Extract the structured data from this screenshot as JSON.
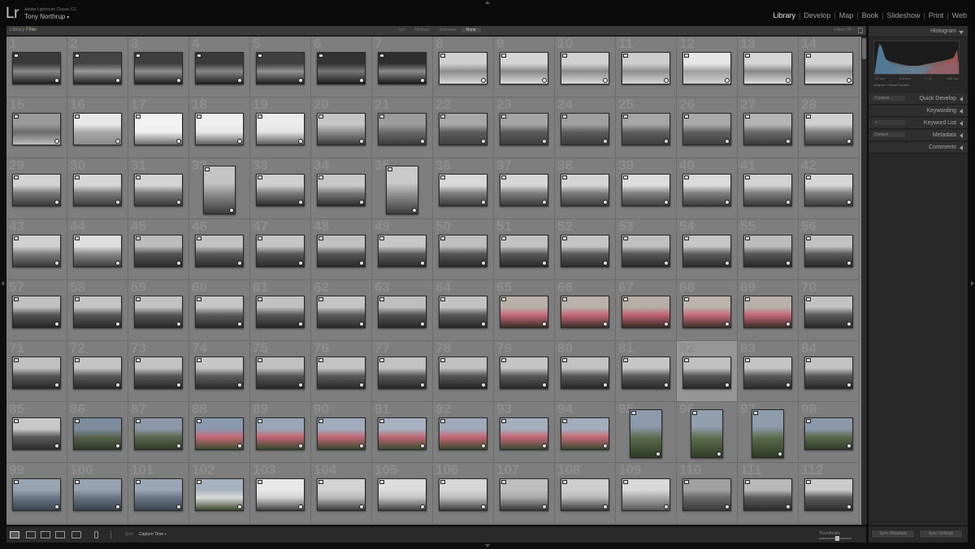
{
  "app": {
    "logo": "Lr",
    "app_name": "Adobe Lightroom Classic CC",
    "user_name": "Tony Northrup",
    "user_caret": "▾"
  },
  "modules": [
    {
      "label": "Library",
      "active": true
    },
    {
      "label": "Develop",
      "active": false
    },
    {
      "label": "Map",
      "active": false
    },
    {
      "label": "Book",
      "active": false
    },
    {
      "label": "Slideshow",
      "active": false
    },
    {
      "label": "Print",
      "active": false
    },
    {
      "label": "Web",
      "active": false
    }
  ],
  "filter_bar": {
    "title_prefix": "Library ",
    "title_accent": "Filter",
    "tabs": [
      {
        "label": "Text",
        "active": false
      },
      {
        "label": "Attribute",
        "active": false
      },
      {
        "label": "Metadata",
        "active": false
      },
      {
        "label": "None",
        "active": true
      }
    ],
    "filters_off": "Filters Off ÷"
  },
  "grid": {
    "columns": 14,
    "rows": 8,
    "selected_index": 81,
    "cells": [
      {
        "n": "1",
        "o": "land",
        "c": [
          "#3a3a3a",
          "#8a8a8a",
          "#1e1e1e"
        ]
      },
      {
        "n": "2",
        "o": "land",
        "c": [
          "#444",
          "#999",
          "#222"
        ]
      },
      {
        "n": "3",
        "o": "land",
        "c": [
          "#3e3e3e",
          "#8e8e8e",
          "#1f1f1f"
        ]
      },
      {
        "n": "4",
        "o": "land",
        "c": [
          "#3a3a3a",
          "#888",
          "#202020"
        ]
      },
      {
        "n": "5",
        "o": "land",
        "c": [
          "#3f3f3f",
          "#929292",
          "#1e1e1e"
        ]
      },
      {
        "n": "6",
        "o": "land",
        "c": [
          "#333",
          "#777",
          "#1a1a1a"
        ]
      },
      {
        "n": "7",
        "o": "land",
        "c": [
          "#2e2e2e",
          "#8a8a8a",
          "#181818"
        ]
      },
      {
        "n": "8",
        "o": "land",
        "c": [
          "#cfcfcf",
          "#8c8c8c",
          "#d8d8d8"
        ]
      },
      {
        "n": "9",
        "o": "land",
        "c": [
          "#d4d4d4",
          "#888",
          "#dcdcdc"
        ]
      },
      {
        "n": "10",
        "o": "land",
        "c": [
          "#d0d0d0",
          "#8a8a8a",
          "#dadada"
        ]
      },
      {
        "n": "11",
        "o": "land",
        "c": [
          "#cdcdcd",
          "#8e8e8e",
          "#d6d6d6"
        ]
      },
      {
        "n": "12",
        "o": "land",
        "c": [
          "#e6e6e6",
          "#a0a0a0",
          "#d0d0d0"
        ]
      },
      {
        "n": "13",
        "o": "land",
        "c": [
          "#d6d6d6",
          "#868686",
          "#dcdcdc"
        ]
      },
      {
        "n": "14",
        "o": "land",
        "c": [
          "#d2d2d2",
          "#888",
          "#dadada"
        ]
      },
      {
        "n": "15",
        "o": "land",
        "c": [
          "#9a9a9a",
          "#6a6a6a",
          "#bdbdbd"
        ]
      },
      {
        "n": "16",
        "o": "land",
        "c": [
          "#e8e8e8",
          "#a8a8a8",
          "#8a8a8a"
        ]
      },
      {
        "n": "17",
        "o": "land",
        "c": [
          "#f2f2f2",
          "#f0f0f0",
          "#6a6a6a"
        ]
      },
      {
        "n": "18",
        "o": "land",
        "c": [
          "#eeeeee",
          "#e6e6e6",
          "#5e5e5e"
        ]
      },
      {
        "n": "19",
        "o": "land",
        "c": [
          "#ececec",
          "#e2e2e2",
          "#585858"
        ]
      },
      {
        "n": "20",
        "o": "land",
        "c": [
          "#c6c6c6",
          "#8c8c8c",
          "#3a3a3a"
        ]
      },
      {
        "n": "21",
        "o": "land",
        "c": [
          "#9c9c9c",
          "#6a6a6a",
          "#3a3a3a"
        ]
      },
      {
        "n": "22",
        "o": "land",
        "c": [
          "#a8a8a8",
          "#5c5c5c",
          "#404040"
        ]
      },
      {
        "n": "23",
        "o": "land",
        "c": [
          "#a4a4a4",
          "#5a5a5a",
          "#3e3e3e"
        ]
      },
      {
        "n": "24",
        "o": "land",
        "c": [
          "#a0a0a0",
          "#5c5c5c",
          "#3a3a3a"
        ]
      },
      {
        "n": "25",
        "o": "land",
        "c": [
          "#a6a6a6",
          "#5e5e5e",
          "#3c3c3c"
        ]
      },
      {
        "n": "26",
        "o": "land",
        "c": [
          "#aaaaaa",
          "#606060",
          "#3e3e3e"
        ]
      },
      {
        "n": "27",
        "o": "land",
        "c": [
          "#b4b4b4",
          "#6a6a6a",
          "#3a3a3a"
        ]
      },
      {
        "n": "28",
        "o": "land",
        "c": [
          "#cfcfcf",
          "#7e7e7e",
          "#3c3c3c"
        ]
      },
      {
        "n": "29",
        "o": "land",
        "c": [
          "#d2d2d2",
          "#7a7a7a",
          "#3a3a3a"
        ]
      },
      {
        "n": "30",
        "o": "land",
        "c": [
          "#d6d6d6",
          "#7c7c7c",
          "#3c3c3c"
        ]
      },
      {
        "n": "31",
        "o": "land",
        "c": [
          "#d4d4d4",
          "#7a7a7a",
          "#3a3a3a"
        ]
      },
      {
        "n": "32",
        "o": "port",
        "c": [
          "#c4c4c4",
          "#8a8a8a",
          "#3a3a3a"
        ]
      },
      {
        "n": "33",
        "o": "land",
        "c": [
          "#cfcfcf",
          "#7c7c7c",
          "#2e2e2e"
        ]
      },
      {
        "n": "34",
        "o": "land",
        "c": [
          "#c8c8c8",
          "#7a7a7a",
          "#2c2c2c"
        ]
      },
      {
        "n": "35",
        "o": "port",
        "c": [
          "#cacaca",
          "#8e8e8e",
          "#3e3e3e"
        ]
      },
      {
        "n": "36",
        "o": "land",
        "c": [
          "#d8d8d8",
          "#808080",
          "#3a3a3a"
        ]
      },
      {
        "n": "37",
        "o": "land",
        "c": [
          "#d6d6d6",
          "#7e7e7e",
          "#3a3a3a"
        ]
      },
      {
        "n": "38",
        "o": "land",
        "c": [
          "#d4d4d4",
          "#7c7c7c",
          "#3c3c3c"
        ]
      },
      {
        "n": "39",
        "o": "land",
        "c": [
          "#dcdcdc",
          "#828282",
          "#3e3e3e"
        ]
      },
      {
        "n": "40",
        "o": "land",
        "c": [
          "#dadada",
          "#808080",
          "#3c3c3c"
        ]
      },
      {
        "n": "41",
        "o": "land",
        "c": [
          "#d2d2d2",
          "#7e7e7e",
          "#3a3a3a"
        ]
      },
      {
        "n": "42",
        "o": "land",
        "c": [
          "#d6d6d6",
          "#808080",
          "#3c3c3c"
        ]
      },
      {
        "n": "43",
        "o": "land",
        "c": [
          "#d0d0d0",
          "#7c7c7c",
          "#3a3a3a"
        ]
      },
      {
        "n": "44",
        "o": "land",
        "c": [
          "#dedede",
          "#888",
          "#404040"
        ]
      },
      {
        "n": "45",
        "o": "land",
        "c": [
          "#bcbcbc",
          "#545454",
          "#2a2a2a"
        ]
      },
      {
        "n": "46",
        "o": "land",
        "c": [
          "#c2c2c2",
          "#5a5a5a",
          "#2c2c2c"
        ]
      },
      {
        "n": "47",
        "o": "land",
        "c": [
          "#c4c4c4",
          "#585858",
          "#2a2a2a"
        ]
      },
      {
        "n": "48",
        "o": "land",
        "c": [
          "#c0c0c0",
          "#565656",
          "#2a2a2a"
        ]
      },
      {
        "n": "49",
        "o": "land",
        "c": [
          "#c6c6c6",
          "#5a5a5a",
          "#2c2c2c"
        ]
      },
      {
        "n": "50",
        "o": "land",
        "c": [
          "#bebebe",
          "#565656",
          "#282828"
        ]
      },
      {
        "n": "51",
        "o": "land",
        "c": [
          "#c2c2c2",
          "#585858",
          "#2a2a2a"
        ]
      },
      {
        "n": "52",
        "o": "land",
        "c": [
          "#c4c4c4",
          "#5a5a5a",
          "#2c2c2c"
        ]
      },
      {
        "n": "53",
        "o": "land",
        "c": [
          "#c0c0c0",
          "#585858",
          "#2a2a2a"
        ]
      },
      {
        "n": "54",
        "o": "land",
        "c": [
          "#c6c6c6",
          "#5c5c5c",
          "#2c2c2c"
        ]
      },
      {
        "n": "55",
        "o": "land",
        "c": [
          "#bcbcbc",
          "#565656",
          "#282828"
        ]
      },
      {
        "n": "56",
        "o": "land",
        "c": [
          "#c2c2c2",
          "#5a5a5a",
          "#2a2a2a"
        ]
      },
      {
        "n": "57",
        "o": "land",
        "c": [
          "#c0c0c0",
          "#545454",
          "#262626"
        ]
      },
      {
        "n": "58",
        "o": "land",
        "c": [
          "#c4c4c4",
          "#585858",
          "#2a2a2a"
        ]
      },
      {
        "n": "59",
        "o": "land",
        "c": [
          "#c2c2c2",
          "#565656",
          "#282828"
        ]
      },
      {
        "n": "60",
        "o": "land",
        "c": [
          "#c6c6c6",
          "#5a5a5a",
          "#2a2a2a"
        ]
      },
      {
        "n": "61",
        "o": "land",
        "c": [
          "#c0c0c0",
          "#585858",
          "#282828"
        ]
      },
      {
        "n": "62",
        "o": "land",
        "c": [
          "#c4c4c4",
          "#5a5a5a",
          "#2a2a2a"
        ]
      },
      {
        "n": "63",
        "o": "land",
        "c": [
          "#bebebe",
          "#545454",
          "#262626"
        ]
      },
      {
        "n": "64",
        "o": "land",
        "c": [
          "#c2c2c2",
          "#585858",
          "#282828"
        ]
      },
      {
        "n": "65",
        "o": "land",
        "c": [
          "#b8b0a8",
          "#c86a7a",
          "#3a2e28"
        ]
      },
      {
        "n": "66",
        "o": "land",
        "c": [
          "#bab2aa",
          "#c46678",
          "#3c302a"
        ]
      },
      {
        "n": "67",
        "o": "land",
        "c": [
          "#b6aea6",
          "#c26274",
          "#3a2c26"
        ]
      },
      {
        "n": "68",
        "o": "land",
        "c": [
          "#bcb4ac",
          "#c66a7a",
          "#3c302a"
        ]
      },
      {
        "n": "69",
        "o": "land",
        "c": [
          "#b8b0a8",
          "#c46878",
          "#3a2e28"
        ]
      },
      {
        "n": "70",
        "o": "land",
        "c": [
          "#c2c2c2",
          "#5a5a5a",
          "#2a2a2a"
        ]
      },
      {
        "n": "71",
        "o": "land",
        "c": [
          "#c0c0c0",
          "#565656",
          "#282828"
        ]
      },
      {
        "n": "72",
        "o": "land",
        "c": [
          "#c4c4c4",
          "#5a5a5a",
          "#2a2a2a"
        ]
      },
      {
        "n": "73",
        "o": "land",
        "c": [
          "#c2c2c2",
          "#585858",
          "#282828"
        ]
      },
      {
        "n": "74",
        "o": "land",
        "c": [
          "#c6c6c6",
          "#5c5c5c",
          "#2c2c2c"
        ]
      },
      {
        "n": "75",
        "o": "land",
        "c": [
          "#c0c0c0",
          "#565656",
          "#282828"
        ]
      },
      {
        "n": "76",
        "o": "land",
        "c": [
          "#c4c4c4",
          "#5a5a5a",
          "#2a2a2a"
        ]
      },
      {
        "n": "77",
        "o": "land",
        "c": [
          "#c2c2c2",
          "#585858",
          "#282828"
        ]
      },
      {
        "n": "78",
        "o": "land",
        "c": [
          "#c0c0c0",
          "#565656",
          "#262626"
        ]
      },
      {
        "n": "79",
        "o": "land",
        "c": [
          "#c4c4c4",
          "#5a5a5a",
          "#2a2a2a"
        ]
      },
      {
        "n": "80",
        "o": "land",
        "c": [
          "#c2c2c2",
          "#585858",
          "#282828"
        ]
      },
      {
        "n": "81",
        "o": "land",
        "c": [
          "#c6c6c6",
          "#5a5a5a",
          "#2a2a2a"
        ]
      },
      {
        "n": "82",
        "o": "land",
        "c": [
          "#c0c0c0",
          "#565656",
          "#282828"
        ]
      },
      {
        "n": "83",
        "o": "land",
        "c": [
          "#c4c4c4",
          "#5a5a5a",
          "#2a2a2a"
        ]
      },
      {
        "n": "84",
        "o": "land",
        "c": [
          "#c2c2c2",
          "#585858",
          "#282828"
        ]
      },
      {
        "n": "85",
        "o": "land",
        "c": [
          "#c8c8c8",
          "#5c5c5c",
          "#2c2c2c"
        ]
      },
      {
        "n": "86",
        "o": "land",
        "c": [
          "#7e8ca0",
          "#5a6450",
          "#2e3a26"
        ]
      },
      {
        "n": "87",
        "o": "land",
        "c": [
          "#8c98a8",
          "#5e6a52",
          "#303c28"
        ]
      },
      {
        "n": "88",
        "o": "land",
        "c": [
          "#8a98b0",
          "#c86a7a",
          "#3e4c2e"
        ]
      },
      {
        "n": "89",
        "o": "land",
        "c": [
          "#9aa6b8",
          "#c46678",
          "#3a4a2c"
        ]
      },
      {
        "n": "90",
        "o": "land",
        "c": [
          "#a0acbc",
          "#c46878",
          "#3c4a2e"
        ]
      },
      {
        "n": "91",
        "o": "land",
        "c": [
          "#a6b2c0",
          "#c26876",
          "#3e4c30"
        ]
      },
      {
        "n": "92",
        "o": "land",
        "c": [
          "#9eaaba",
          "#c66878",
          "#3c4a2e"
        ]
      },
      {
        "n": "93",
        "o": "land",
        "c": [
          "#a4b0be",
          "#c46878",
          "#3e4c30"
        ]
      },
      {
        "n": "94",
        "o": "land",
        "c": [
          "#a2aebc",
          "#c66a7a",
          "#3c4a2e"
        ]
      },
      {
        "n": "95",
        "o": "port",
        "c": [
          "#8c9aac",
          "#5a6a4a",
          "#2e3a24"
        ]
      },
      {
        "n": "96",
        "o": "port",
        "c": [
          "#909eae",
          "#5c6c4c",
          "#303c26"
        ]
      },
      {
        "n": "97",
        "o": "port",
        "c": [
          "#8e9cac",
          "#5a6a4a",
          "#2e3a24"
        ]
      },
      {
        "n": "98",
        "o": "land",
        "c": [
          "#8a98aa",
          "#5c6c4e",
          "#303c28"
        ]
      },
      {
        "n": "99",
        "o": "land",
        "c": [
          "#98a4b2",
          "#6a7686",
          "#3a4450"
        ]
      },
      {
        "n": "100",
        "o": "land",
        "c": [
          "#96a2b0",
          "#687484",
          "#38424e"
        ]
      },
      {
        "n": "101",
        "o": "land",
        "c": [
          "#9aa6b4",
          "#6a7686",
          "#3a4450"
        ]
      },
      {
        "n": "102",
        "o": "land",
        "c": [
          "#a6b2c0",
          "#dadada",
          "#3c4a2e"
        ]
      },
      {
        "n": "103",
        "o": "land",
        "c": [
          "#e8e8e8",
          "#d0d0d0",
          "#444"
        ]
      },
      {
        "n": "104",
        "o": "land",
        "c": [
          "#d2d2d2",
          "#b8b8b8",
          "#3c3c3c"
        ]
      },
      {
        "n": "105",
        "o": "land",
        "c": [
          "#dcdcdc",
          "#c4c4c4",
          "#404040"
        ]
      },
      {
        "n": "106",
        "o": "land",
        "c": [
          "#d6d6d6",
          "#bcbcbc",
          "#3e3e3e"
        ]
      },
      {
        "n": "107",
        "o": "land",
        "c": [
          "#bebebe",
          "#a6a6a6",
          "#383838"
        ]
      },
      {
        "n": "108",
        "o": "land",
        "c": [
          "#cecece",
          "#b6b6b6",
          "#3c3c3c"
        ]
      },
      {
        "n": "109",
        "o": "land",
        "c": [
          "#d8d8d8",
          "#a8a8a8",
          "#5a5a5a"
        ]
      },
      {
        "n": "110",
        "o": "land",
        "c": [
          "#a0a0a0",
          "#686868",
          "#3a3a3a"
        ]
      },
      {
        "n": "111",
        "o": "land",
        "c": [
          "#b8b8b8",
          "#5a5a5a",
          "#2e2e2e"
        ]
      },
      {
        "n": "112",
        "o": "land",
        "c": [
          "#cacaca",
          "#5c5c5c",
          "#2e2e2e"
        ]
      }
    ]
  },
  "right_panel": {
    "histogram_title": "Histogram",
    "histogram_readout": [
      "1/2 sec",
      "114 mm",
      "f / 11",
      "1/50 sec"
    ],
    "preview_label": "Original + Smart Preview",
    "panels": [
      {
        "title": "Quick Develop",
        "left": "Custom"
      },
      {
        "title": "Keywording",
        "left": ""
      },
      {
        "title": "Keyword List",
        "left": "+"
      },
      {
        "title": "Metadata",
        "left": "Default"
      },
      {
        "title": "Comments",
        "left": ""
      }
    ],
    "sync_metadata": "Sync Metadata",
    "sync_settings": "Sync Settings"
  },
  "toolbar": {
    "sort_label": "Sort:",
    "sort_value": "Capture Time ÷",
    "thumbnails_label": "Thumbnails"
  },
  "colors": {
    "accent": "#a8c08a",
    "grid_bg": "#878787",
    "cell_bg": "#7e7e7e",
    "panel_bg": "#282828",
    "top_bg": "#0b0b0b",
    "pink": "#c86a7a"
  }
}
